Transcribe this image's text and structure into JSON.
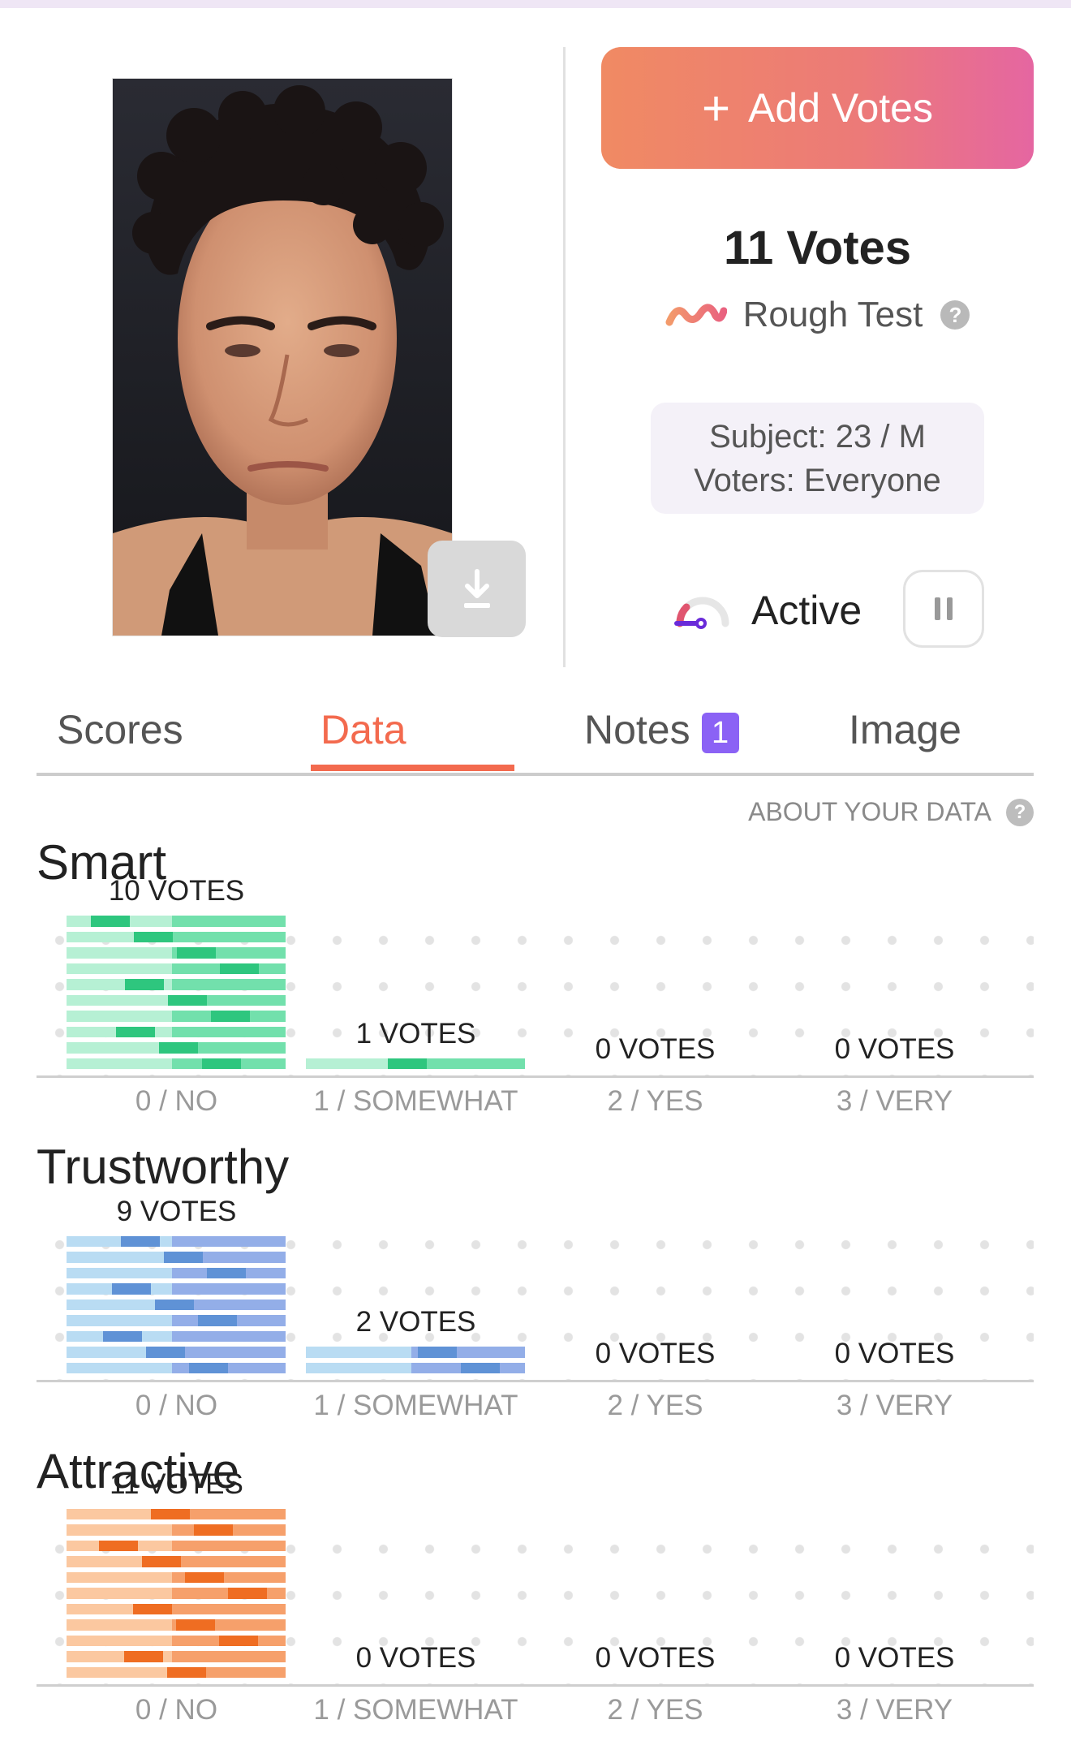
{
  "add_button": {
    "label": "Add Votes"
  },
  "summary": {
    "votes_title": "11 Votes",
    "test_type": "Rough Test"
  },
  "subject": {
    "line1": "Subject: 23 / M",
    "line2": "Voters: Everyone"
  },
  "status": {
    "label": "Active"
  },
  "tabs": [
    {
      "label": "Scores",
      "active": false
    },
    {
      "label": "Data",
      "active": true
    },
    {
      "label": "Notes",
      "active": false,
      "badge": "1"
    },
    {
      "label": "Image",
      "active": false
    }
  ],
  "about_data": "ABOUT YOUR DATA",
  "chart_data": [
    {
      "type": "bar",
      "title": "Smart",
      "categories": [
        "0 / NO",
        "1 / SOMEWHAT",
        "2 / YES",
        "3 / VERY"
      ],
      "values": [
        10,
        1,
        0,
        0
      ],
      "value_labels": [
        "10 VOTES",
        "1 VOTES",
        "0 VOTES",
        "0 VOTES"
      ],
      "colors": {
        "light": "#b6f0d4",
        "mid": "#72e0ac",
        "dark": "#2ec67e"
      }
    },
    {
      "type": "bar",
      "title": "Trustworthy",
      "categories": [
        "0 / NO",
        "1 / SOMEWHAT",
        "2 / YES",
        "3 / VERY"
      ],
      "values": [
        9,
        2,
        0,
        0
      ],
      "value_labels": [
        "9 VOTES",
        "2 VOTES",
        "0 VOTES",
        "0 VOTES"
      ],
      "colors": {
        "light": "#b9dcf3",
        "mid": "#93aee8",
        "dark": "#5f92d6"
      }
    },
    {
      "type": "bar",
      "title": "Attractive",
      "categories": [
        "0 / NO",
        "1 / SOMEWHAT",
        "2 / YES",
        "3 / VERY"
      ],
      "values": [
        11,
        0,
        0,
        0
      ],
      "value_labels": [
        "11 VOTES",
        "0 VOTES",
        "0 VOTES",
        "0 VOTES"
      ],
      "colors": {
        "light": "#fbc8a0",
        "mid": "#f6a06b",
        "dark": "#ef6d22"
      }
    }
  ]
}
